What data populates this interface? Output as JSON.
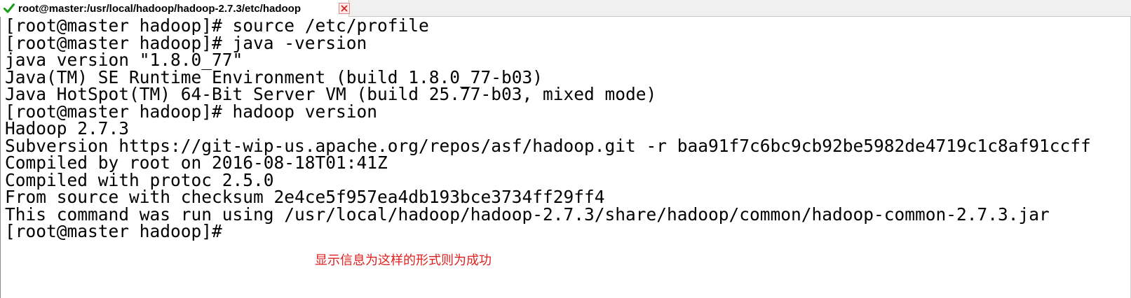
{
  "tab": {
    "title": "root@master:/usr/local/hadoop/hadoop-2.7.3/etc/hadoop",
    "status_icon": "checkmark-icon",
    "close_icon": "close-icon",
    "status_color": "#1a9e1a",
    "close_color": "#cc2222"
  },
  "terminal": {
    "lines": [
      "[root@master hadoop]# source /etc/profile",
      "[root@master hadoop]# java -version",
      "java version \"1.8.0_77\"",
      "Java(TM) SE Runtime Environment (build 1.8.0_77-b03)",
      "Java HotSpot(TM) 64-Bit Server VM (build 25.77-b03, mixed mode)",
      "[root@master hadoop]# hadoop version",
      "Hadoop 2.7.3",
      "Subversion https://git-wip-us.apache.org/repos/asf/hadoop.git -r baa91f7c6bc9cb92be5982de4719c1c8af91ccff",
      "Compiled by root on 2016-08-18T01:41Z",
      "Compiled with protoc 2.5.0",
      "From source with checksum 2e4ce5f957ea4db193bce3734ff29ff4",
      "This command was run using /usr/local/hadoop/hadoop-2.7.3/share/hadoop/common/hadoop-common-2.7.3.jar",
      "[root@master hadoop]#"
    ],
    "text_color": "#000000",
    "background": "#ffffff"
  },
  "annotation": {
    "text": "显示信息为这样的形式则为成功",
    "color": "#e02020"
  }
}
